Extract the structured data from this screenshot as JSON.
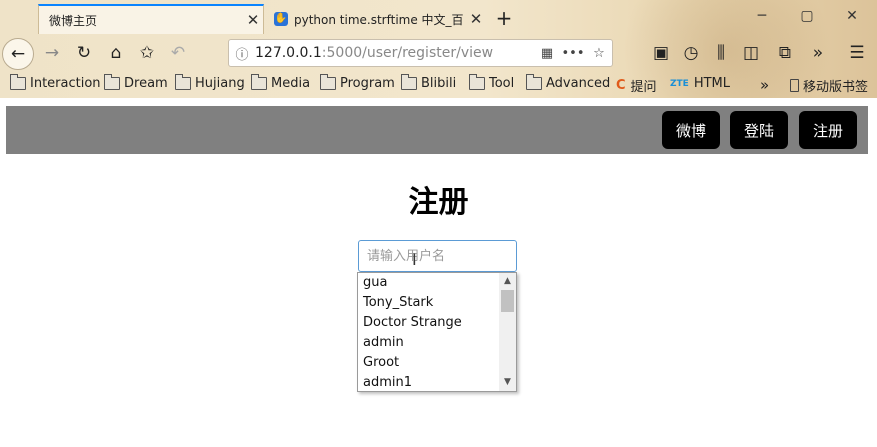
{
  "browser": {
    "tabs": [
      {
        "title": "微博主页",
        "active": true
      },
      {
        "title": "python time.strftime 中文_百"
      }
    ],
    "url": {
      "host": "127.0.0.1",
      "rest": ":5000/user/register/view"
    },
    "bookmarks": [
      "Interaction",
      "Dream",
      "Hujiang",
      "Media",
      "Program",
      "Blibili",
      "Tool",
      "Advanced",
      "提问",
      "HTML",
      "移动版书签"
    ],
    "bookmark_prefixes": {
      "html": "ZTE"
    }
  },
  "site_nav": {
    "buttons": [
      "微博",
      "登陆",
      "注册"
    ]
  },
  "page": {
    "title": "注册",
    "username_placeholder": "请输入用户名"
  },
  "autocomplete": {
    "items": [
      "gua",
      "Tony_Stark",
      "Doctor Strange",
      "admin",
      "Groot",
      "admin1"
    ]
  }
}
